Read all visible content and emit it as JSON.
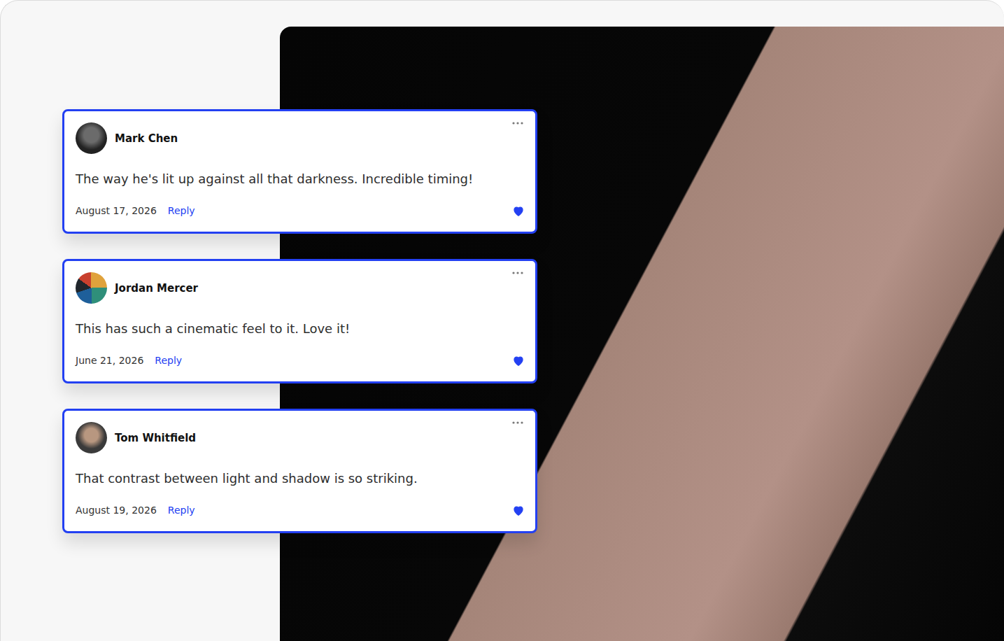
{
  "comments": [
    {
      "author": "Mark Chen",
      "text": "The way he's lit up against all that darkness. Incredible timing!",
      "date": "August 17, 2026",
      "reply": "Reply",
      "liked": true
    },
    {
      "author": "Jordan Mercer",
      "text": "This has such a cinematic feel to it. Love it!",
      "date": "June 21, 2026",
      "reply": "Reply",
      "liked": true
    },
    {
      "author": "Tom Whitfield",
      "text": "That contrast between light and shadow is so striking.",
      "date": "August 19, 2026",
      "reply": "Reply",
      "liked": true
    }
  ]
}
